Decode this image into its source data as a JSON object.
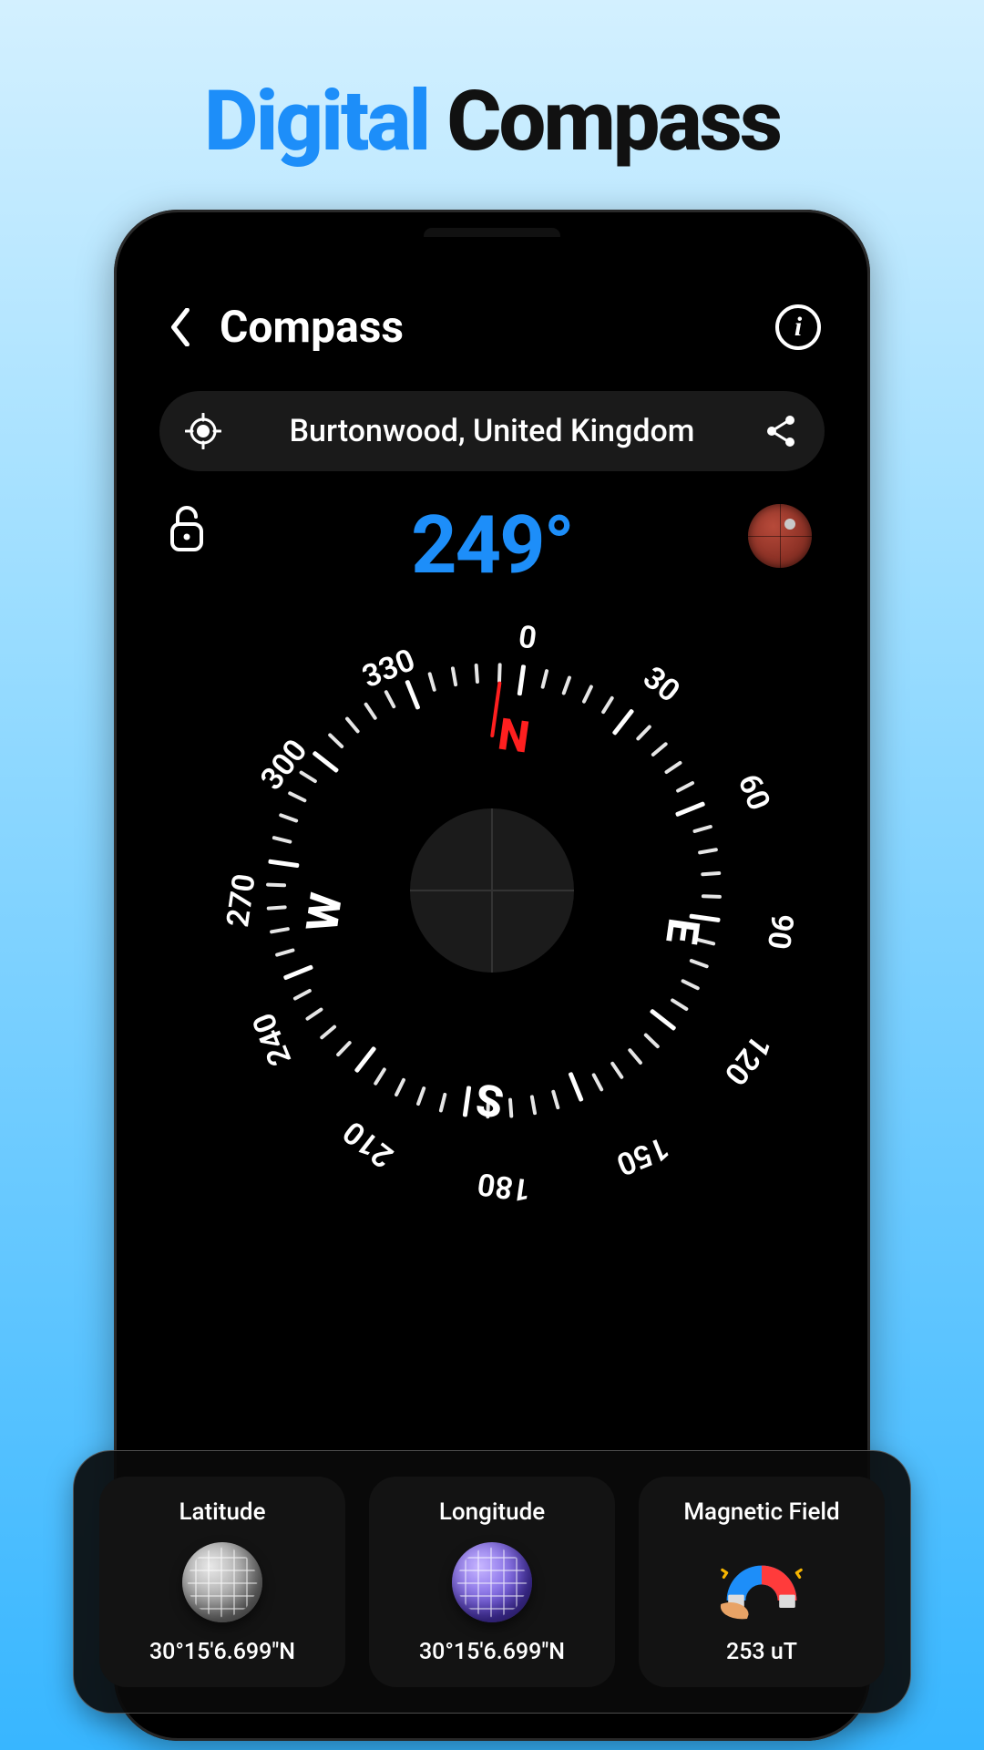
{
  "promo": {
    "word1": "Digital",
    "word2": "Compass"
  },
  "header": {
    "title": "Compass",
    "info_label": "i"
  },
  "location": {
    "name": "Burtonwood, United Kingdom"
  },
  "heading": {
    "degrees": "249°",
    "angle": 249
  },
  "compass": {
    "cardinals": {
      "N": "N",
      "E": "E",
      "S": "S",
      "W": "W"
    },
    "deg_marks": [
      "0",
      "30",
      "60",
      "90",
      "120",
      "150",
      "180",
      "210",
      "240",
      "270",
      "300",
      "330"
    ]
  },
  "panel": {
    "latitude": {
      "label": "Latitude",
      "value": "30°15'6.699\"N"
    },
    "longitude": {
      "label": "Longitude",
      "value": "30°15'6.699\"N"
    },
    "magnetic": {
      "label": "Magnetic Field",
      "value": "253 uT"
    }
  }
}
